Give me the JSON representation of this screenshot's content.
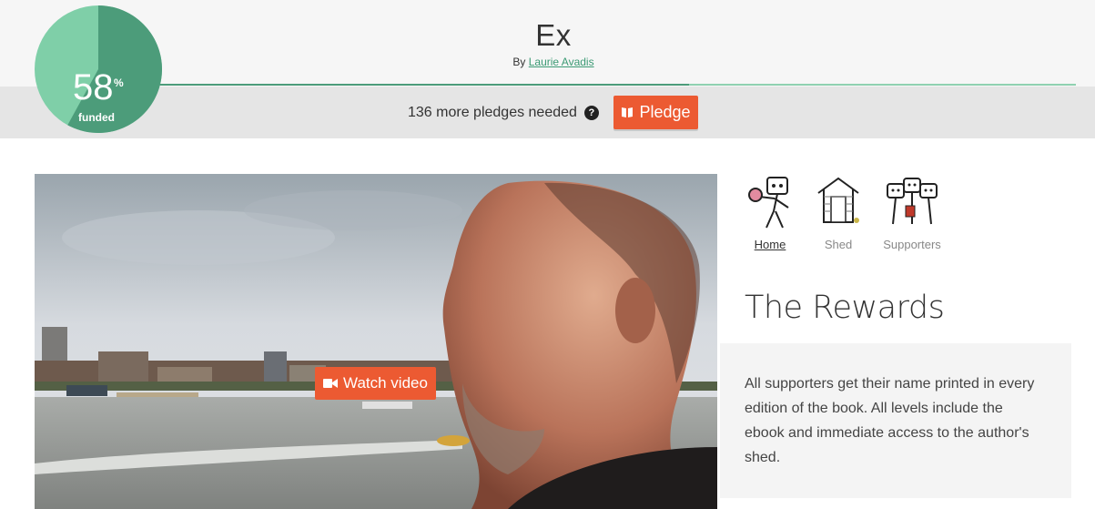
{
  "project": {
    "title": "Ex",
    "by_prefix": "By",
    "author": "Laurie Avadis"
  },
  "funding": {
    "percent": "58",
    "percent_sign": "%",
    "funded_label": "funded",
    "fraction": 0.58,
    "colors": {
      "funded": "#4c9c7a",
      "remaining": "#7fcfa8"
    }
  },
  "pledge_bar": {
    "needed_text": "136 more pledges needed",
    "help_icon": "question-circle-icon",
    "button_label": "Pledge",
    "button_icon": "book-icon",
    "accent": "#ec5a32"
  },
  "video": {
    "button_label": "Watch video",
    "button_icon": "video-camera-icon"
  },
  "nav": {
    "items": [
      {
        "label": "Home",
        "active": true,
        "icon": "author-illustration-icon"
      },
      {
        "label": "Shed",
        "active": false,
        "icon": "shed-illustration-icon"
      },
      {
        "label": "Supporters",
        "active": false,
        "icon": "supporters-illustration-icon"
      }
    ]
  },
  "rewards": {
    "title": "The Rewards",
    "description": "All supporters get their name printed in every edition of the book. All levels include the ebook and immediate access to the author's shed."
  }
}
